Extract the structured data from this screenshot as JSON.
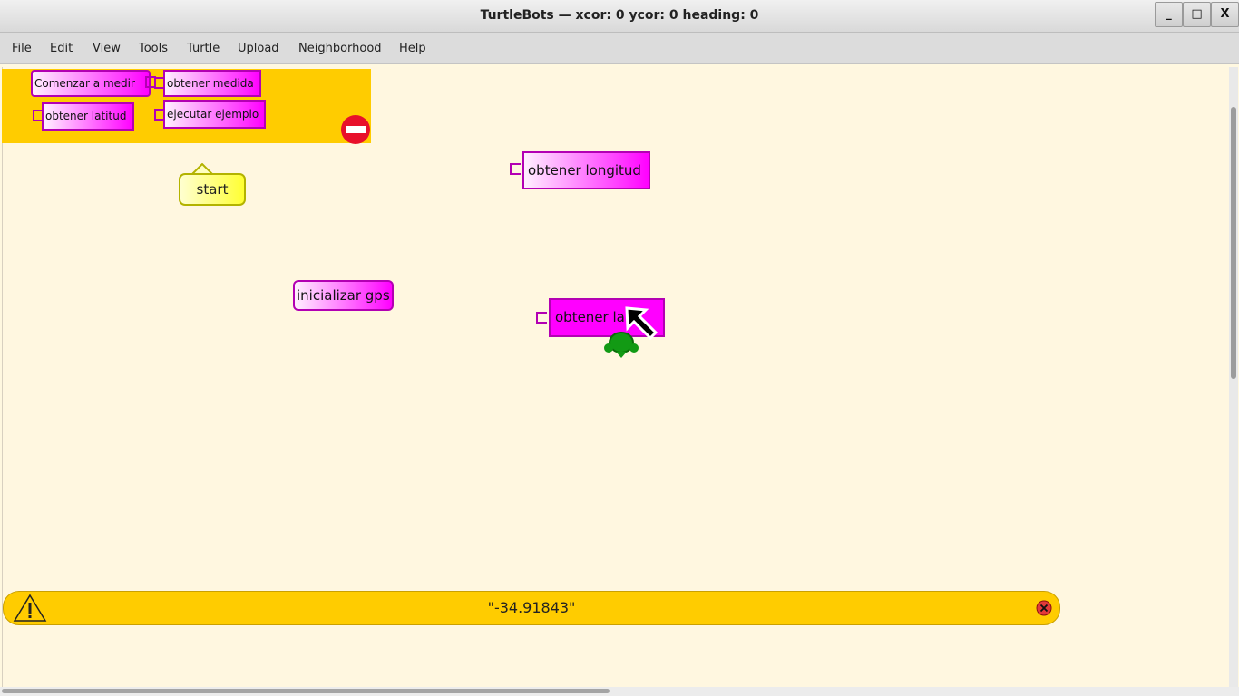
{
  "window": {
    "title": "TurtleBots — xcor: 0 ycor: 0 heading: 0",
    "buttons": {
      "minimize": "_",
      "maximize": "□",
      "close": "X"
    }
  },
  "menu": [
    "File",
    "Edit",
    "View",
    "Tools",
    "Turtle",
    "Upload",
    "Neighborhood",
    "Help"
  ],
  "palette": {
    "blocks": [
      "Comenzar a medir",
      "obtener medida",
      "obtener latitud",
      "ejecutar ejemplo"
    ]
  },
  "canvas": {
    "start_label": "start",
    "blocks": [
      "obtener longitud",
      "inicializar gps",
      "obtener la"
    ]
  },
  "alert": {
    "text": "\"-34.91843\""
  },
  "colors": {
    "palette_bg": "#ffcc00",
    "canvas_bg": "#fff7e0",
    "block_magenta": "#ff00ff",
    "block_border": "#b300b3",
    "start_yellow": "#ffff33"
  }
}
